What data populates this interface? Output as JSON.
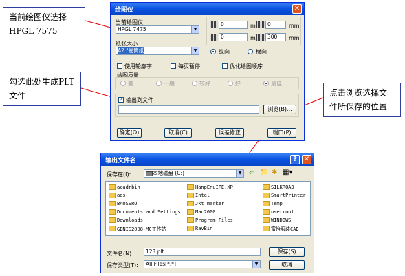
{
  "callouts": {
    "plotter": "当前绘图仪选择HPGL 7575",
    "plt": "勾选此处生成PLT文件",
    "browse": "点击浏览选择文件所保存的位置"
  },
  "plot_dialog": {
    "title": "绘图仪",
    "plotter_label": "当前绘图仪",
    "plotter_value": "HPGL 7475",
    "paper_label": "纸张大小",
    "paper_value": "A2 \"卷筒纸",
    "margin_top": "0",
    "margin_bottom": "0",
    "margin_left": "0",
    "margin_right": "300",
    "unit": "mm",
    "portrait": "纵向",
    "landscape": "横向",
    "use_outline_font": "使用轮廓字",
    "pause_per_page": "每页暂停",
    "optimize_order": "优化绘图顺序",
    "quality_label": "绘图质量",
    "quality_options": [
      "差",
      "一般",
      "较好",
      "好",
      "最佳"
    ],
    "output_to_file": "输出到文件",
    "browse": "浏览(B)...",
    "ok": "确定(O)",
    "cancel": "取消(C)",
    "error_correction": "误差修正",
    "port": "端口(P)"
  },
  "save_dialog": {
    "title": "输出文件名",
    "save_in_label": "保存在(I):",
    "save_in_value": "本地磁盘 (C:)",
    "files": [
      "acadrbin",
      "ads",
      "BAOSSRO",
      "Documents and Settings",
      "Downloads",
      "GENIS2008-MC工作站",
      "HanpEnuIPE.XP",
      "Intel",
      "Jkt marker",
      "Mac2000",
      "Program Files",
      "RavBin",
      "SILKROAD",
      "SmartPrinter",
      "Temp",
      "userroot",
      "WINDOWS",
      "富怡服装CAD"
    ],
    "filename_label": "文件名(N):",
    "filename_value": "123.plt",
    "filetype_label": "保存类型(T):",
    "filetype_value": "All Files[*.*]",
    "save": "保存(S)",
    "cancel": "取消"
  }
}
